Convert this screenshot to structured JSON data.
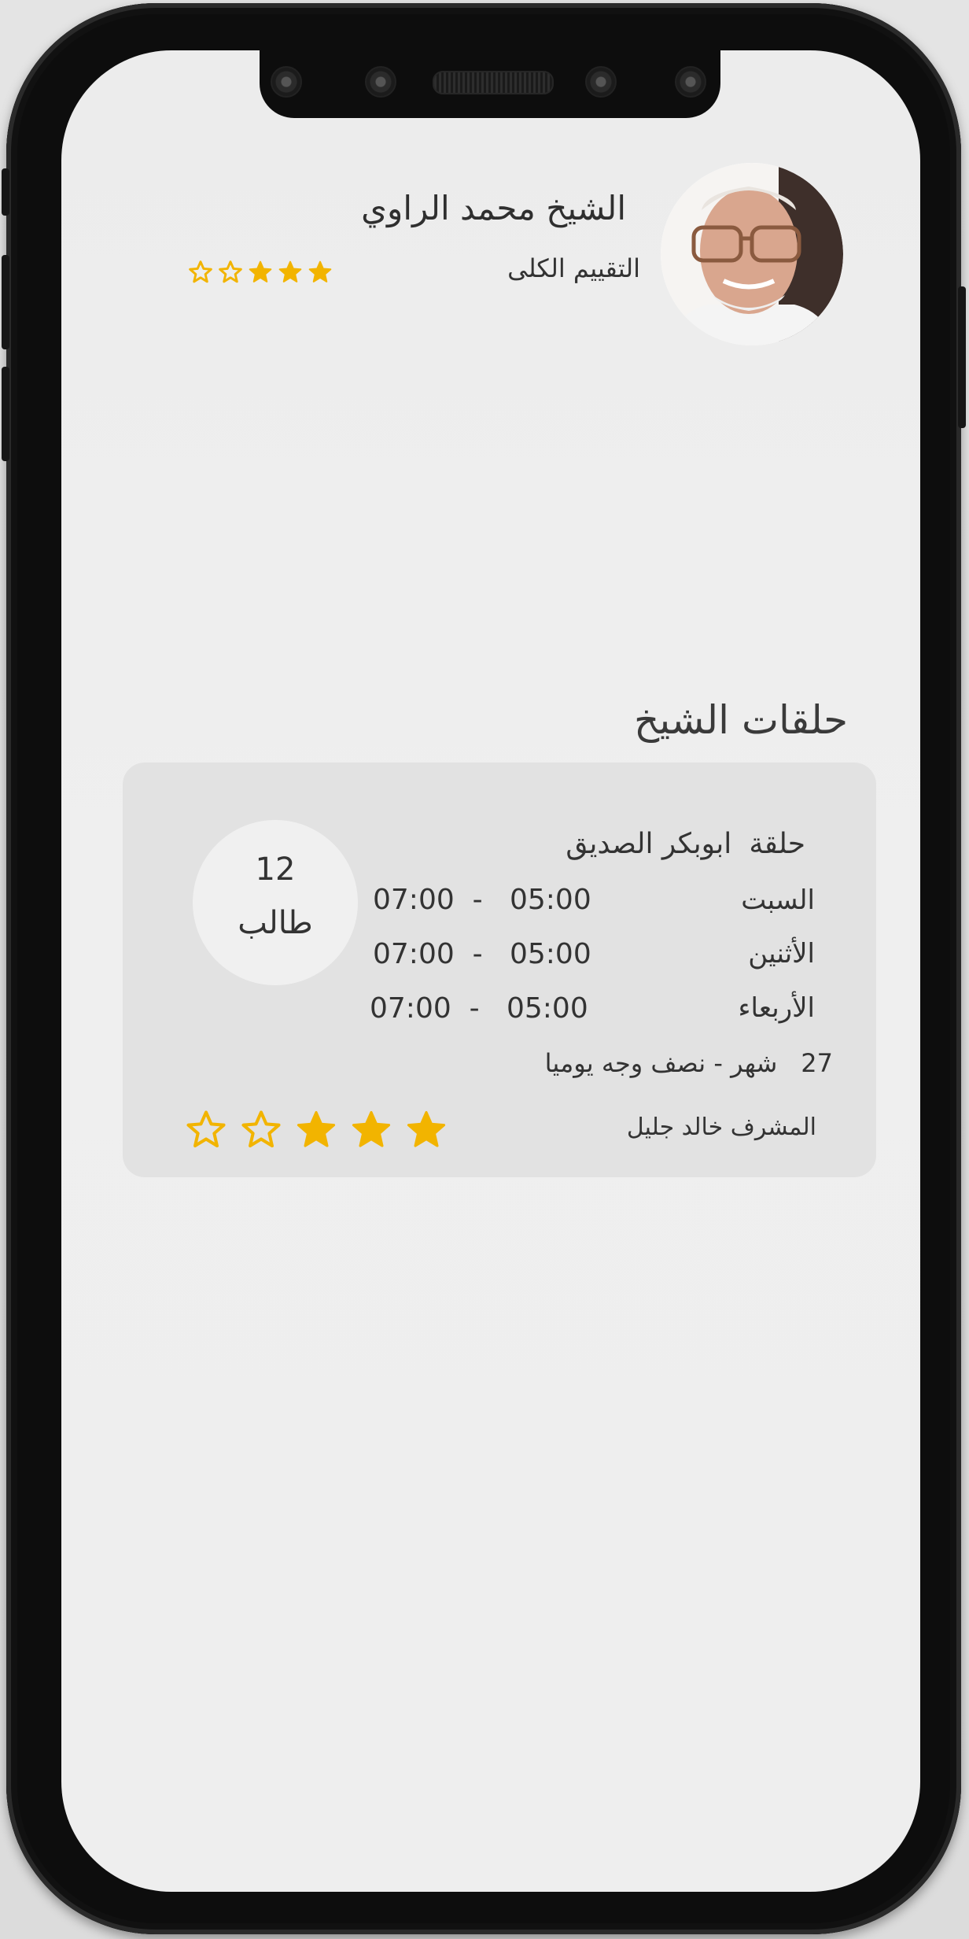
{
  "profile": {
    "name": "الشيخ محمد الراوي",
    "rating_label": "التقييم الكلى",
    "rating": 3,
    "rating_max": 5
  },
  "section": {
    "title": "حلقات الشيخ"
  },
  "circle_card": {
    "title_word": "حلقة",
    "title_name": "ابوبكر الصديق",
    "student_count": "12",
    "student_unit": "طالب",
    "schedule": [
      {
        "day": "السبت",
        "from": "05:00",
        "sep": "-",
        "to": "07:00"
      },
      {
        "day": "الأثنين",
        "from": "05:00",
        "sep": "-",
        "to": "07:00"
      },
      {
        "day": "الأربعاء",
        "from": "05:00",
        "sep": "-",
        "to": "07:00"
      }
    ],
    "duration_number": "27",
    "duration_text": "شهر - نصف وجه يوميا",
    "supervisor": "المشرف خالد جليل",
    "rating": 3,
    "rating_max": 5
  },
  "colors": {
    "star": "#f2b400",
    "card_bg": "#e2e2e2",
    "screen_bg": "#efefef",
    "text": "#333333"
  },
  "icons": {
    "filled_star": "star-filled-icon",
    "outline_star": "star-outline-icon"
  }
}
